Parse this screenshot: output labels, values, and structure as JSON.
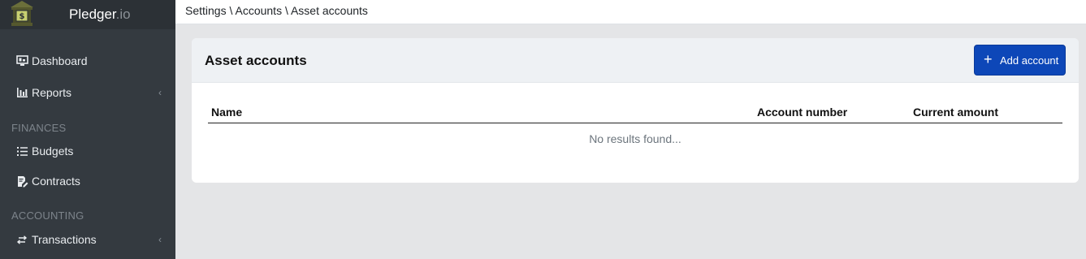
{
  "brand": {
    "name": "Pledger",
    "tld": ".io"
  },
  "sidebar": {
    "items": [
      {
        "label": "Dashboard",
        "icon": "monitor-icon"
      },
      {
        "label": "Reports",
        "icon": "bar-chart-icon",
        "chevron": "‹"
      },
      {
        "section": "FINANCES"
      },
      {
        "label": "Budgets",
        "icon": "list-icon"
      },
      {
        "label": "Contracts",
        "icon": "file-edit-icon"
      },
      {
        "section": "ACCOUNTING"
      },
      {
        "label": "Transactions",
        "icon": "swap-arrows-icon",
        "chevron": "‹"
      }
    ]
  },
  "breadcrumb": "Settings \\ Accounts \\ Asset accounts",
  "card": {
    "title": "Asset accounts",
    "add_button": {
      "plus": "+",
      "label": "Add account"
    }
  },
  "table": {
    "columns": [
      "Name",
      "Account number",
      "Current amount"
    ],
    "empty_message": "No results found..."
  },
  "colors": {
    "sidebar_bg": "#343a40",
    "brand_bg": "#2c3136",
    "accent": "#0d47b8",
    "page_bg": "#e4e5e7"
  }
}
